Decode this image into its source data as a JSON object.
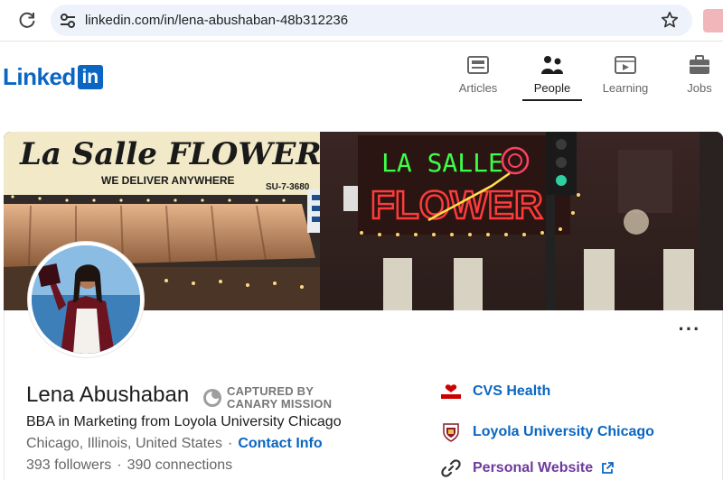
{
  "browser": {
    "url": "linkedin.com/in/lena-abushaban-48b312236"
  },
  "nav": {
    "logo_word": "Linked",
    "logo_in": "in",
    "items": [
      {
        "label": "Articles",
        "icon": "articles-icon",
        "active": false
      },
      {
        "label": "People",
        "icon": "people-icon",
        "active": true
      },
      {
        "label": "Learning",
        "icon": "learning-icon",
        "active": false
      },
      {
        "label": "Jobs",
        "icon": "jobs-icon",
        "active": false
      }
    ]
  },
  "banner": {
    "sign_top": "La Salle FLOWER SHOP",
    "sign_sub": "WE DELIVER ANYWHERE",
    "sign_phone": "SU-7-3680",
    "neon_top": "LA SALLE",
    "neon_bottom": "FLOWER"
  },
  "profile": {
    "name": "Lena Abushaban",
    "badge_line1": "CAPTURED BY",
    "badge_line2": "CANARY MISSION",
    "headline": "BBA in Marketing from Loyola University Chicago",
    "location": "Chicago, Illinois, United States",
    "separator": "·",
    "contact_label": "Contact Info",
    "followers": "393 followers",
    "connections": "390 connections",
    "more": "···"
  },
  "right_panel": {
    "company": "CVS Health",
    "company_logo_text": "CVS Health",
    "school": "Loyola University Chicago",
    "website": "Personal Website"
  },
  "colors": {
    "linkedin_blue": "#0a66c2",
    "link_purple": "#6e3a9c",
    "muted": "#666666",
    "cvs_red": "#cc0000"
  }
}
